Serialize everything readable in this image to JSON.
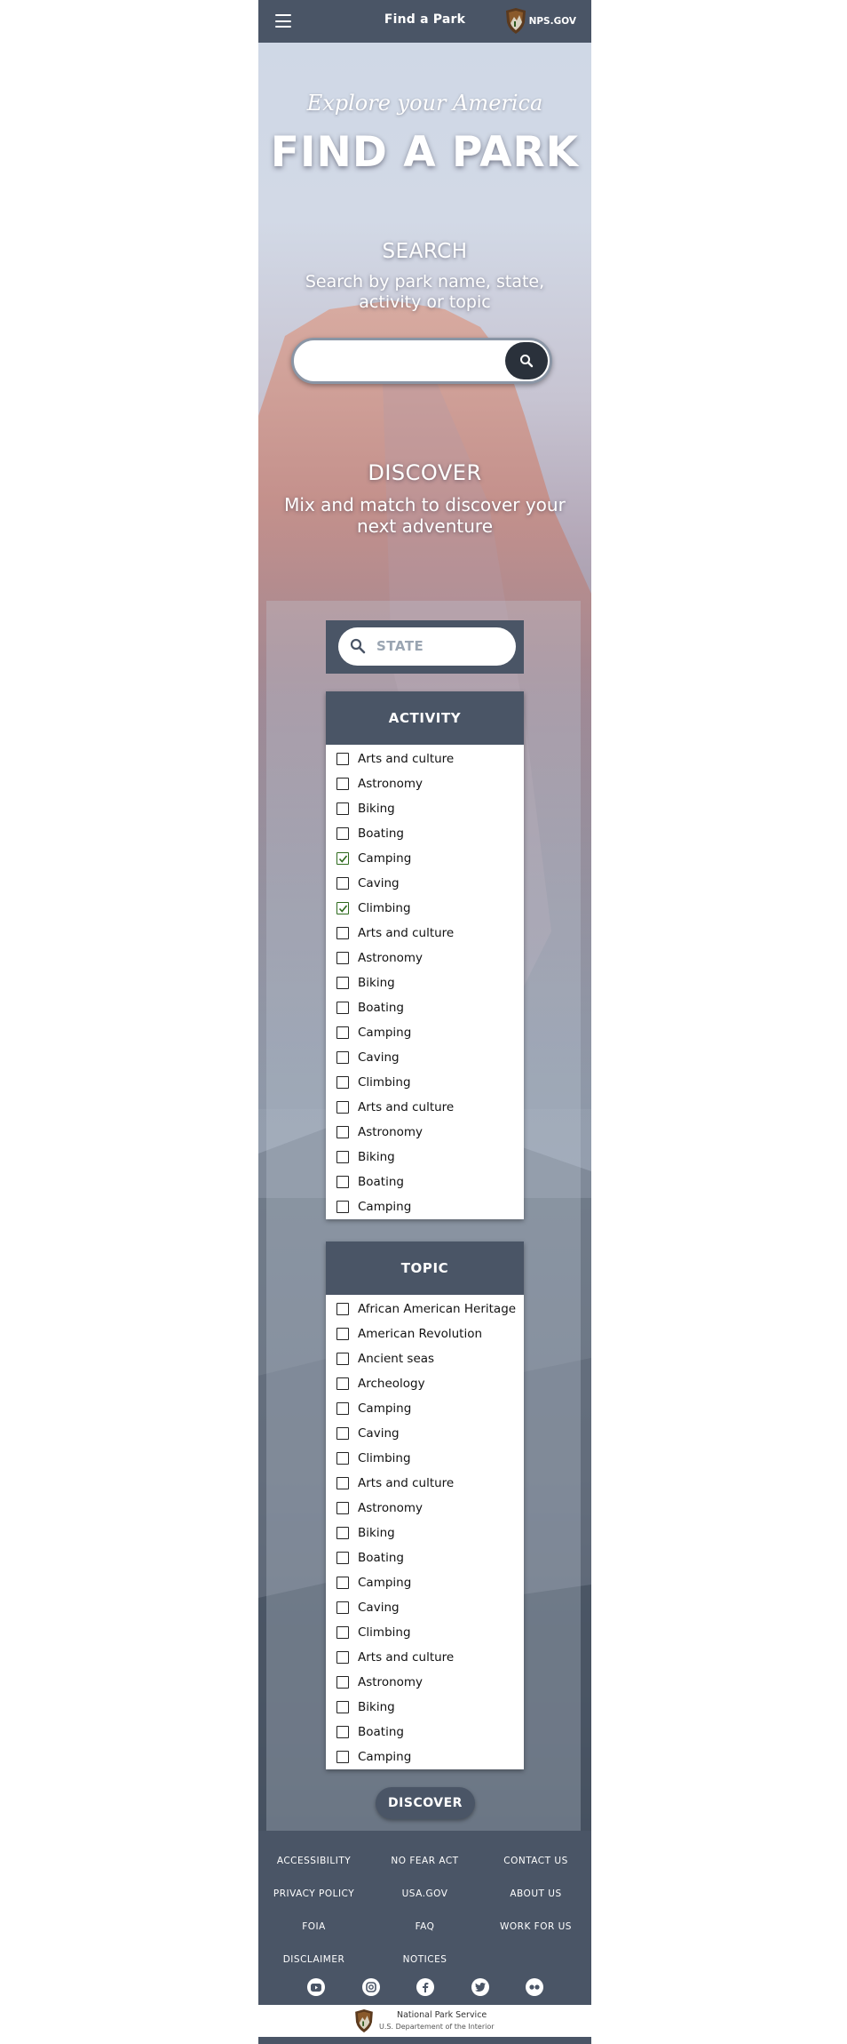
{
  "header": {
    "title": "Find a Park",
    "brand": "NPS.GOV"
  },
  "hero": {
    "tagline": "Explore your America",
    "title": "FIND A PARK",
    "search_heading": "SEARCH",
    "search_subtitle": "Search by park name, state, activity or topic",
    "search_value": "",
    "discover_heading": "DISCOVER",
    "discover_subtitle": "Mix and match to discover your next adventure"
  },
  "filters": {
    "state_placeholder": "STATE",
    "activity": {
      "heading": "ACTIVITY",
      "options": [
        {
          "label": "Arts and culture",
          "checked": false
        },
        {
          "label": "Astronomy",
          "checked": false
        },
        {
          "label": "Biking",
          "checked": false
        },
        {
          "label": "Boating",
          "checked": false
        },
        {
          "label": "Camping",
          "checked": true
        },
        {
          "label": "Caving",
          "checked": false
        },
        {
          "label": "Climbing",
          "checked": true
        },
        {
          "label": "Arts and culture",
          "checked": false
        },
        {
          "label": "Astronomy",
          "checked": false
        },
        {
          "label": "Biking",
          "checked": false
        },
        {
          "label": "Boating",
          "checked": false
        },
        {
          "label": "Camping",
          "checked": false
        },
        {
          "label": "Caving",
          "checked": false
        },
        {
          "label": "Climbing",
          "checked": false
        },
        {
          "label": "Arts and culture",
          "checked": false
        },
        {
          "label": "Astronomy",
          "checked": false
        },
        {
          "label": "Biking",
          "checked": false
        },
        {
          "label": "Boating",
          "checked": false
        },
        {
          "label": "Camping",
          "checked": false
        }
      ]
    },
    "topic": {
      "heading": "TOPIC",
      "options": [
        {
          "label": "African American Heritage",
          "checked": false
        },
        {
          "label": "American Revolution",
          "checked": false
        },
        {
          "label": "Ancient seas",
          "checked": false
        },
        {
          "label": "Archeology",
          "checked": false
        },
        {
          "label": "Camping",
          "checked": false
        },
        {
          "label": "Caving",
          "checked": false
        },
        {
          "label": "Climbing",
          "checked": false
        },
        {
          "label": "Arts and culture",
          "checked": false
        },
        {
          "label": "Astronomy",
          "checked": false
        },
        {
          "label": "Biking",
          "checked": false
        },
        {
          "label": "Boating",
          "checked": false
        },
        {
          "label": "Camping",
          "checked": false
        },
        {
          "label": "Caving",
          "checked": false
        },
        {
          "label": "Climbing",
          "checked": false
        },
        {
          "label": "Arts and culture",
          "checked": false
        },
        {
          "label": "Astronomy",
          "checked": false
        },
        {
          "label": "Biking",
          "checked": false
        },
        {
          "label": "Boating",
          "checked": false
        },
        {
          "label": "Camping",
          "checked": false
        }
      ]
    },
    "discover_button": "DISCOVER"
  },
  "footer": {
    "links": [
      "ACCESSIBILITY",
      "NO FEAR ACT",
      "CONTACT US",
      "PRIVACY POLICY",
      "USA.GOV",
      "ABOUT US",
      "FOIA",
      "FAQ",
      "WORK FOR US",
      "DISCLAIMER",
      "NOTICES"
    ],
    "social_icons": [
      "youtube-icon",
      "instagram-icon",
      "facebook-icon",
      "twitter-icon",
      "flickr-icon"
    ],
    "org_name": "National Park Service",
    "dept_name": "U.S. Departement of the Interior"
  },
  "colors": {
    "header_bg": "#4a5566",
    "search_button": "#2a313b",
    "check": "#2d6a1c"
  }
}
